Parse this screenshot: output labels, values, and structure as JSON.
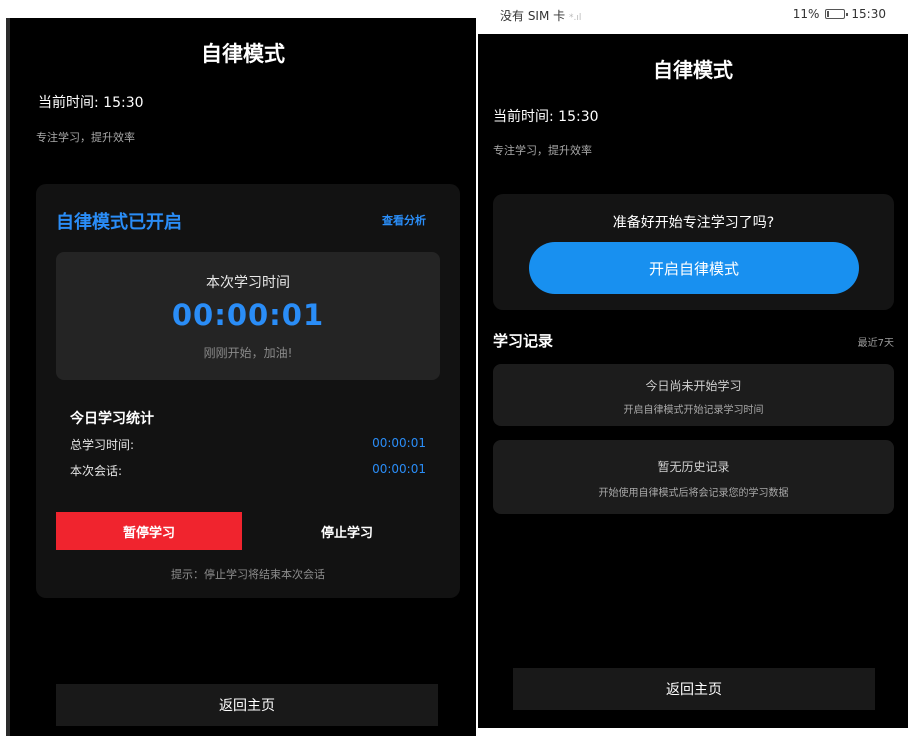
{
  "left": {
    "title": "自律模式",
    "current_time": "当前时间: 15:30",
    "slogan": "专注学习，提升效率",
    "active_title": "自律模式已开启",
    "analysis_link": "查看分析",
    "timer_label": "本次学习时间",
    "timer_value": "00:00:01",
    "timer_hint": "刚刚开始，加油!",
    "stats_title": "今日学习统计",
    "stats": [
      {
        "label": "总学习时间:",
        "value": "00:00:01"
      },
      {
        "label": "本次会话:",
        "value": "00:00:01"
      }
    ],
    "pause_label": "暂停学习",
    "stop_label": "停止学习",
    "tip": "提示：停止学习将结束本次会话",
    "home_label": "返回主页"
  },
  "statusbar": {
    "carrier": "没有 SIM 卡",
    "signal": "*.ıl",
    "battery": "11%",
    "battery_level": 0.11,
    "time": "15:30"
  },
  "right": {
    "title": "自律模式",
    "current_time": "当前时间: 15:30",
    "slogan": "专注学习，提升效率",
    "ready_question": "准备好开始专注学习了吗?",
    "start_label": "开启自律模式",
    "record_title": "学习记录",
    "record_recent": "最近7天",
    "today_main": "今日尚未开始学习",
    "today_sub": "开启自律模式开始记录学习时间",
    "history_main": "暂无历史记录",
    "history_sub": "开始使用自律模式后将会记录您的学习数据",
    "home_label": "返回主页"
  },
  "colors": {
    "accent": "#2a8df7",
    "start_button": "#1890f0",
    "pause_button": "#f0242e",
    "background": "#000000"
  }
}
